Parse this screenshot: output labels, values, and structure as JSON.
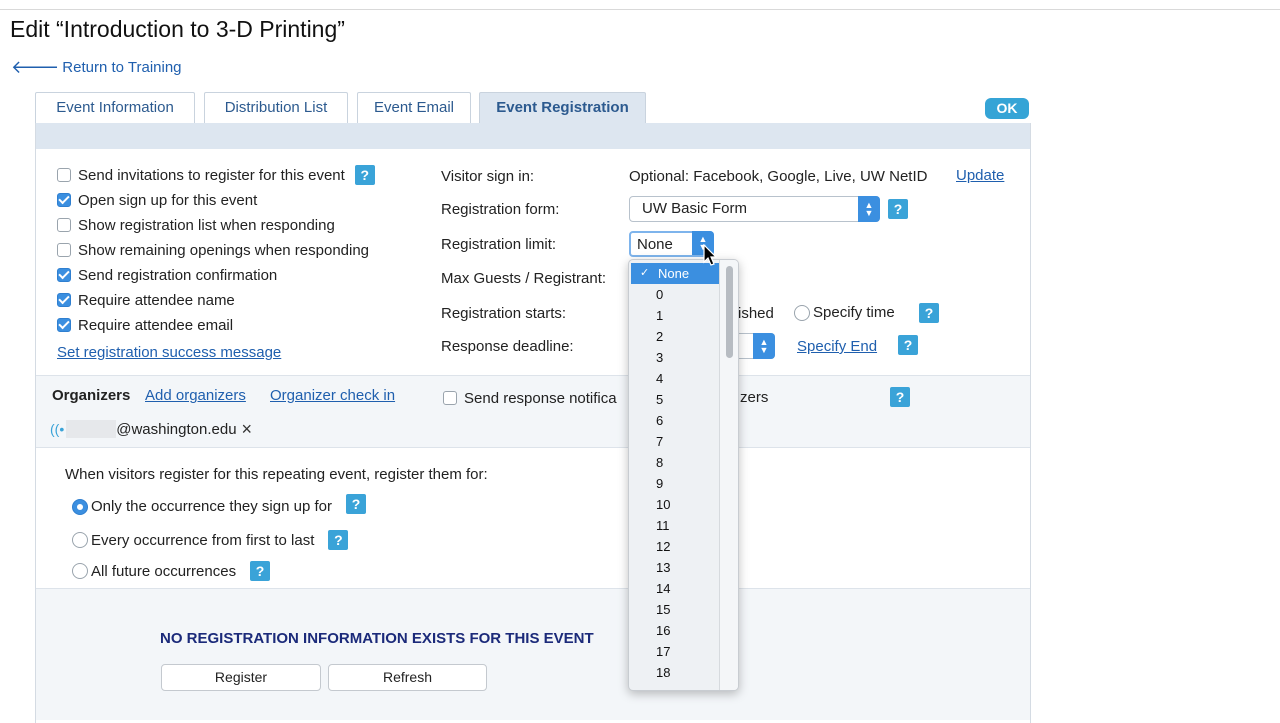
{
  "page": {
    "title": "Edit “Introduction to 3-D Printing”",
    "back_link": "Return to Training"
  },
  "tabs": [
    {
      "label": "Event Information"
    },
    {
      "label": "Distribution List"
    },
    {
      "label": "Event Email"
    },
    {
      "label": "Event Registration",
      "active": true
    }
  ],
  "ok_button": "OK",
  "options": {
    "send_invitations": {
      "label": "Send invitations to register for this event",
      "checked": false
    },
    "open_signup": {
      "label": "Open sign up for this event",
      "checked": true
    },
    "show_reg_list": {
      "label": "Show registration list when responding",
      "checked": false
    },
    "show_remaining": {
      "label": "Show remaining openings when responding",
      "checked": false
    },
    "send_confirmation": {
      "label": "Send registration confirmation",
      "checked": true
    },
    "require_name": {
      "label": "Require attendee name",
      "checked": true
    },
    "require_email": {
      "label": "Require attendee email",
      "checked": true
    },
    "success_message_link": "Set registration success message"
  },
  "settings": {
    "visitor_signin_label": "Visitor sign in:",
    "visitor_signin_value": "Optional: Facebook, Google, Live, UW NetID",
    "update_link": "Update",
    "reg_form_label": "Registration form:",
    "reg_form_value": "UW Basic Form",
    "reg_limit_label": "Registration limit:",
    "reg_limit_value": "None",
    "max_guests_label": "Max Guests / Registrant:",
    "reg_starts_label": "Registration starts:",
    "reg_starts_partial": "ished",
    "specify_time": "Specify time",
    "deadline_label": "Response deadline:",
    "specify_end_link": "Specify End"
  },
  "organizers": {
    "label": "Organizers",
    "add_link": "Add organizers",
    "checkin_link": "Organizer check in",
    "notify_left": "Send response notifica",
    "notify_right": "zers",
    "email": "@washington.edu",
    "remove_icon": "×"
  },
  "repeating": {
    "prompt": "When visitors register for this repeating event, register them for:",
    "options": [
      {
        "label": "Only the occurrence they sign up for",
        "selected": true
      },
      {
        "label": "Every occurrence from first to last",
        "selected": false
      },
      {
        "label": "All future occurrences",
        "selected": false
      }
    ]
  },
  "registration_info": {
    "notice": "NO REGISTRATION INFORMATION EXISTS FOR THIS EVENT",
    "register_button": "Register",
    "refresh_button": "Refresh"
  },
  "dropdown": {
    "items": [
      "None",
      "0",
      "1",
      "2",
      "3",
      "4",
      "5",
      "6",
      "7",
      "8",
      "9",
      "10",
      "11",
      "12",
      "13",
      "14",
      "15",
      "16",
      "17",
      "18"
    ],
    "selected_index": 0
  },
  "help_glyph": "?",
  "colors": {
    "accent": "#3b8fe0",
    "link": "#1f5fae",
    "help": "#3aa3d8",
    "notice": "#1b2a7a"
  }
}
